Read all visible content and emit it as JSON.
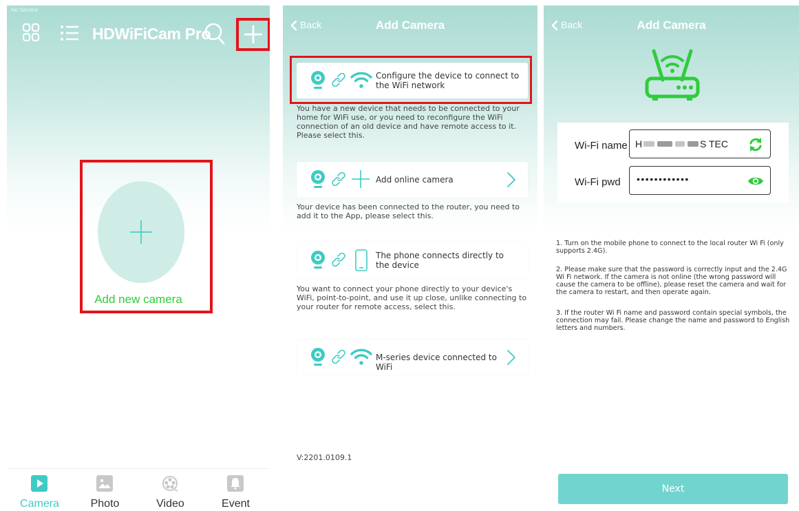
{
  "colors": {
    "teal": "#3ecbc3",
    "green": "#2fcc3b",
    "highlight": "#e3131b",
    "button": "#72d4cf"
  },
  "home": {
    "status_text": "No Service",
    "title": "HDWiFiCam Pro",
    "icons": [
      "grid-icon",
      "list-icon",
      "search-icon",
      "plus-icon"
    ],
    "add_camera_label": "Add new camera",
    "tabs": [
      {
        "label": "Camera",
        "icon": "camera-play-icon",
        "active": true
      },
      {
        "label": "Photo",
        "icon": "photo-icon",
        "active": false
      },
      {
        "label": "Video",
        "icon": "film-reel-icon",
        "active": false
      },
      {
        "label": "Event",
        "icon": "bell-icon",
        "active": false
      }
    ]
  },
  "add_camera": {
    "back": "Back",
    "title": "Add Camera",
    "options": [
      {
        "label": "Configure the device to connect to the WiFi network",
        "description": "You have a new device that needs to be connected to your home for WiFi use, or you need to reconfigure the WiFi connection of an old device and have remote access to it. Please select this."
      },
      {
        "label": "Add online camera",
        "description": "Your device has been connected to the router, you need to add it to the App, please select this."
      },
      {
        "label": "The phone connects directly to the device",
        "description": "You want to connect your phone directly to your device's WiFi, point-to-point, and use it up close, unlike connecting to your router for remote access, select this."
      },
      {
        "label": "M-series device connected to WiFi",
        "description": ""
      }
    ],
    "version": "V:2201.0109.1"
  },
  "wifi": {
    "back": "Back",
    "title": "Add Camera",
    "name_label": "Wi-Fi name",
    "name_value_start": "H",
    "name_value_end": "S TEC",
    "pwd_label": "Wi-Fi pwd",
    "pwd_value": "••••••••••••",
    "notes": [
      "1. Turn on the mobile phone to connect to the local router Wi Fi (only supports 2.4G).",
      "2. Please make sure that the password is correctly input and the 2.4G Wi Fi network. If the camera is not online (the wrong password will cause the camera to be offline), please reset the camera and wait for the camera to restart, and then operate again.",
      "3. If the router Wi Fi name and password contain special symbols, the connection may fail. Please change the name and password to English letters and numbers."
    ],
    "next": "Next"
  }
}
